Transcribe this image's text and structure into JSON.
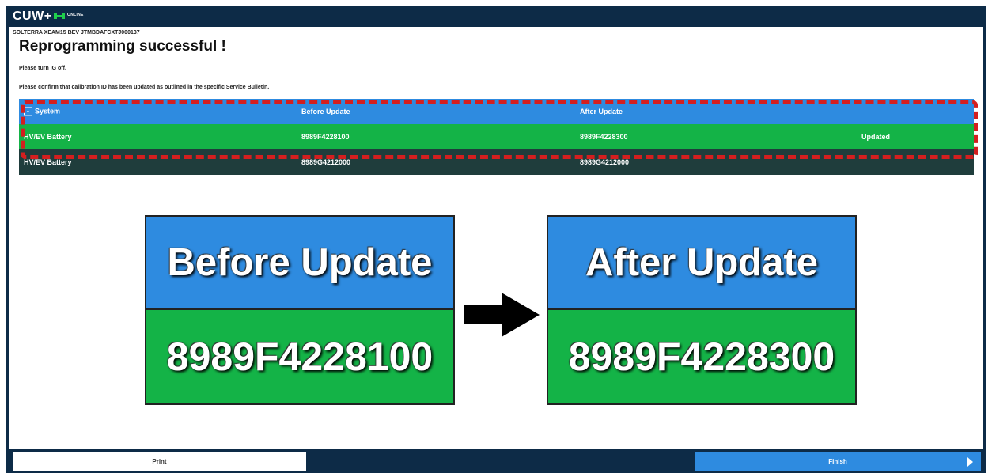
{
  "header": {
    "app_title": "CUW+",
    "status_icon": "connection-status-icon",
    "status_text": "ONLINE"
  },
  "vehicle_info": "SOLTERRA XEAM15 BEV JTMBDAFCXTJ000137",
  "headline": "Reprogramming successful !",
  "messages": [
    "Please turn IG off.",
    "Please confirm that calibration ID has been updated as outlined in the specific Service Bulletin."
  ],
  "table": {
    "columns": [
      "System",
      "Before Update",
      "After Update",
      ""
    ],
    "rows": [
      {
        "system": "HV/EV Battery",
        "before": "8989F4228100",
        "after": "8989F4228300",
        "status": "Updated"
      },
      {
        "system": "HV/EV Battery",
        "before": "8989G4212000",
        "after": "8989G4212000",
        "status": ""
      }
    ]
  },
  "comparison": {
    "before": {
      "title": "Before Update",
      "code": "8989F4228100"
    },
    "after": {
      "title": "After Update",
      "code": "8989F4228300"
    }
  },
  "footer": {
    "print_label": "Print",
    "finish_label": "Finish"
  },
  "colors": {
    "navy": "#0d2b47",
    "blue": "#2e8be0",
    "green": "#14b347",
    "dark_row": "#1f3d3c",
    "highlight_red": "#d41f1f"
  }
}
